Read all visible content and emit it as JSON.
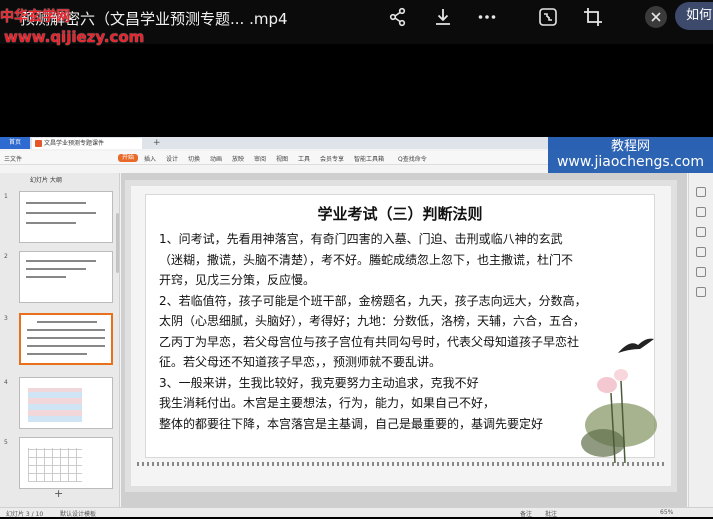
{
  "player": {
    "title": "预测解密六（文昌学业预测专题... .mp4",
    "overlay_brand": "中华玄学网",
    "overlay_url": "www.qijiezy.com",
    "ask_button": "如何",
    "icons": [
      "share-icon",
      "download-icon",
      "more-icon",
      "screenshot-icon",
      "crop-icon",
      "close-icon"
    ]
  },
  "app": {
    "home_tab": "首页",
    "doc_tab": "文昌学业预测专题课件",
    "ribbon_items": [
      "三文件",
      "开始",
      "插入",
      "设计",
      "切换",
      "动画",
      "放映",
      "审阅",
      "视图",
      "工具",
      "会员专享",
      "智能工具箱",
      "Q查找命令"
    ],
    "active_ribbon": "开始",
    "side_tabs": "幻灯片  大纲",
    "slide_numbers": [
      "1",
      "2",
      "3",
      "4",
      "5"
    ],
    "add_slide": "+",
    "status_left": [
      "幻灯片 3 / 10",
      "默认设计模板"
    ],
    "status_right": [
      "备注",
      "批注",
      "65%"
    ]
  },
  "watermark": {
    "name": "教程网",
    "url": "www.jiaochengs.com"
  },
  "slide": {
    "title": "学业考试（三）判断法则",
    "lines": [
      "1、问考试，先看用神落宫，有奇门四害的入墓、门迫、击刑或临八神的玄武",
      "（迷糊，撒谎，头脑不清楚），考不好。螣蛇成绩忽上忽下，也主撒谎，杜门不",
      "开窍，见戊三分策，反应慢。",
      "2、若临值符，孩子可能是个班干部，金榜题名，九天，孩子志向远大，分数高，",
      "太阴（心思细腻，头脑好），考得好；九地：分数低，洛榜，天辅，六合，五合，",
      "乙丙丁为早恋，若父母宫位与孩子宫位有共同勾号时，代表父母知道孩子早恋社",
      "征。若父母还不知道孩子早恋，，预测师就不要乱讲。",
      "3、一般来讲，生我比较好，我克要努力主动追求，克我不好",
      "我生消耗付出。木宫是主要想法，行为，能力，如果自己不好，",
      "整体的都要往下降，本宫落宫是主基调，自己是最重要的，基调先要定好"
    ]
  }
}
